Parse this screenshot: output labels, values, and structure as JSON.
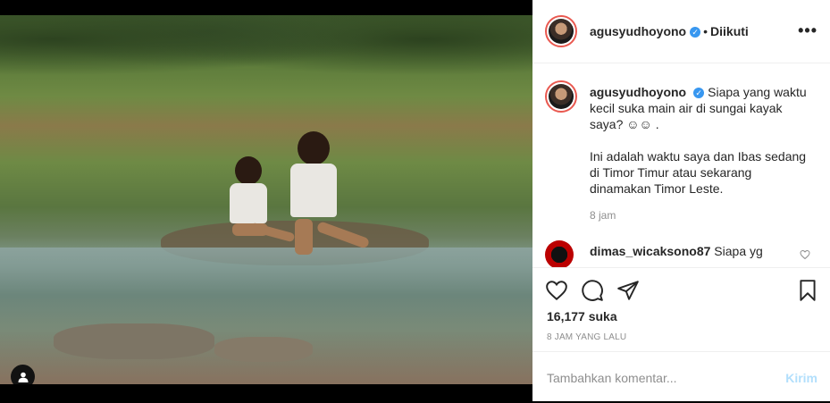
{
  "post": {
    "username": "agusyudhoyono",
    "follow_status": "Diikuti",
    "caption_line1": "Siapa yang waktu kecil suka main air di sungai kayak saya? ☺☺ .",
    "caption_line2": "Ini adalah waktu saya dan Ibas sedang di Timor Timur atau sekarang dinamakan Timor Leste.",
    "caption_time": "8 jam",
    "likes": "16,177 suka",
    "posted_ago": "8 JAM YANG LALU"
  },
  "comments": [
    {
      "username": "dimas_wicaksono87",
      "text": "Siapa yg"
    }
  ],
  "composer": {
    "placeholder": "Tambahkan komentar...",
    "post_label": "Kirim"
  },
  "icons": {
    "more": "more-options-icon",
    "like": "heart-icon",
    "comment": "comment-icon",
    "share": "share-icon",
    "save": "bookmark-icon",
    "tag": "user-tag-icon",
    "verified": "verified-badge-icon"
  },
  "colors": {
    "verified": "#3897f0",
    "post_button": "#b2dffc",
    "muted": "#8e8e8e"
  }
}
